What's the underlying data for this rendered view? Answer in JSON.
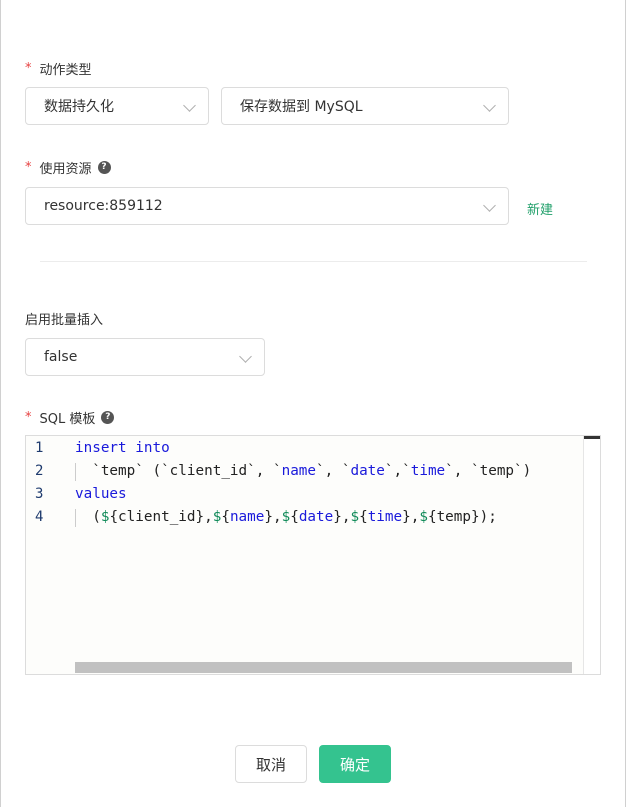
{
  "form": {
    "action_type": {
      "required_mark": "*",
      "label": "动作类型",
      "primary_value": "数据持久化",
      "secondary_value": "保存数据到 MySQL"
    },
    "resource": {
      "required_mark": "*",
      "label": "使用资源",
      "help_glyph": "?",
      "value": "resource:859112",
      "new_link": "新建"
    },
    "batch_insert": {
      "label": "启用批量插入",
      "value": "false"
    },
    "sql_template": {
      "required_mark": "*",
      "label": "SQL 模板",
      "help_glyph": "?",
      "line_numbers": [
        "1",
        "2",
        "3",
        "4"
      ],
      "lines": [
        [
          {
            "t": "insert",
            "c": "kw"
          },
          {
            "t": " ",
            "c": ""
          },
          {
            "t": "into",
            "c": "kw"
          }
        ],
        [
          {
            "t": "  `temp` (`client_id`, `",
            "c": ""
          },
          {
            "t": "name",
            "c": "kw"
          },
          {
            "t": "`, `",
            "c": ""
          },
          {
            "t": "date",
            "c": "kw"
          },
          {
            "t": "`,`",
            "c": ""
          },
          {
            "t": "time",
            "c": "kw"
          },
          {
            "t": "`, `temp`)",
            "c": ""
          }
        ],
        [
          {
            "t": "values",
            "c": "kw"
          }
        ],
        [
          {
            "t": "  (",
            "c": ""
          },
          {
            "t": "$",
            "c": "dollar"
          },
          {
            "t": "{client_id},",
            "c": ""
          },
          {
            "t": "$",
            "c": "dollar"
          },
          {
            "t": "{",
            "c": ""
          },
          {
            "t": "name",
            "c": "kw"
          },
          {
            "t": "},",
            "c": ""
          },
          {
            "t": "$",
            "c": "dollar"
          },
          {
            "t": "{",
            "c": ""
          },
          {
            "t": "date",
            "c": "kw"
          },
          {
            "t": "},",
            "c": ""
          },
          {
            "t": "$",
            "c": "dollar"
          },
          {
            "t": "{",
            "c": ""
          },
          {
            "t": "time",
            "c": "kw"
          },
          {
            "t": "},",
            "c": ""
          },
          {
            "t": "$",
            "c": "dollar"
          },
          {
            "t": "{temp});",
            "c": ""
          }
        ]
      ]
    }
  },
  "footer": {
    "cancel_label": "取消",
    "confirm_label": "确定"
  },
  "colors": {
    "accent": "#34c38f",
    "link": "#22a06b",
    "required": "#e64242",
    "keyword": "#1a1adb",
    "dollar": "#0f8a58"
  }
}
